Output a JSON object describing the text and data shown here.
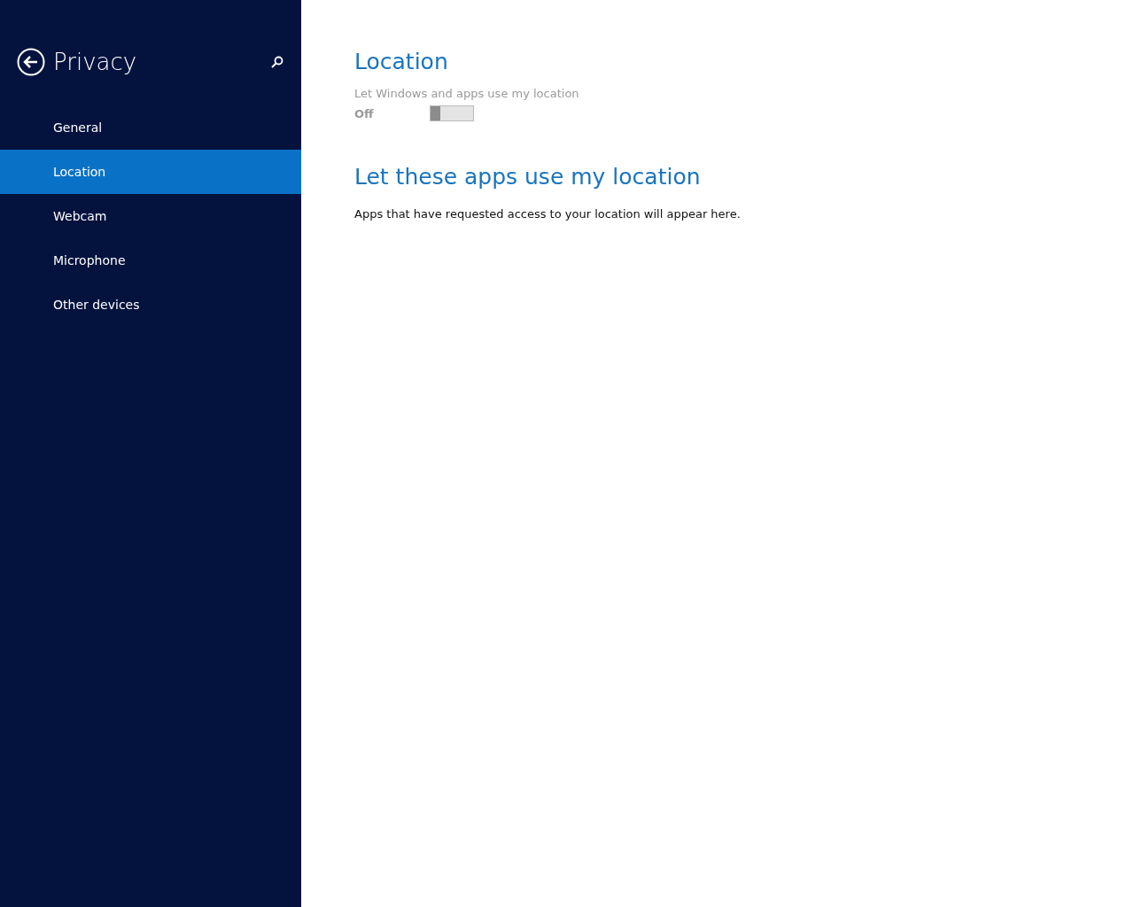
{
  "sidebar": {
    "title": "Privacy",
    "items": [
      {
        "label": "General",
        "selected": false
      },
      {
        "label": "Location",
        "selected": true
      },
      {
        "label": "Webcam",
        "selected": false
      },
      {
        "label": "Microphone",
        "selected": false
      },
      {
        "label": "Other devices",
        "selected": false
      }
    ]
  },
  "content": {
    "heading": "Location",
    "setting": {
      "label": "Let Windows and apps use my location",
      "state_text": "Off",
      "on": false,
      "disabled": true
    },
    "apps_heading": "Let these apps use my location",
    "apps_note": "Apps that have requested access to your location will appear here."
  }
}
